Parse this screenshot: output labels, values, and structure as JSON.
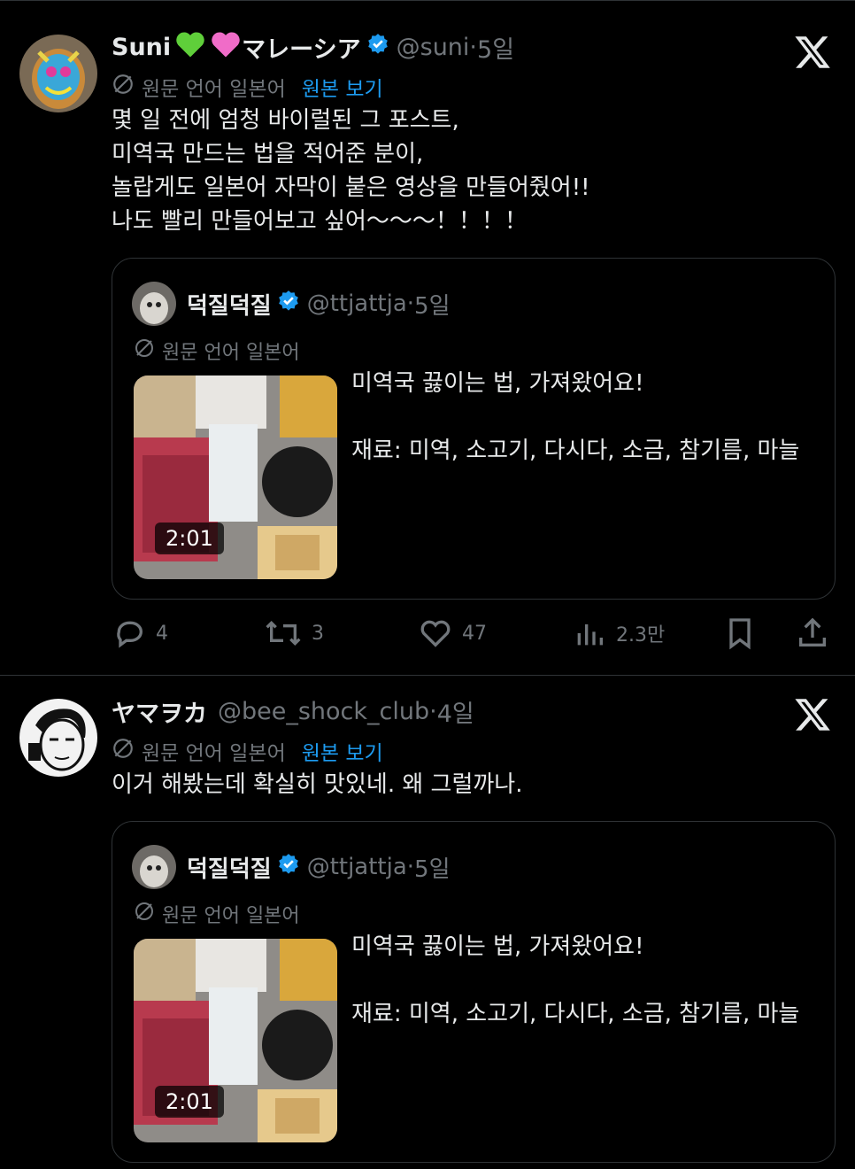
{
  "tweets": [
    {
      "author": {
        "name": "Suni",
        "suffix": "マレーシア",
        "handle": "@suni",
        "time": "5일"
      },
      "lang": {
        "label": "원문 언어 일본어",
        "show_original": "원본 보기"
      },
      "text": "몇 일 전에 엄청 바이럴된 그 포스트,\n미역국 만드는 법을 적어준 분이,\n놀랍게도 일본어 자막이 붙은 영상을 만들어줬어!!\n나도 빨리 만들어보고 싶어～～～！！！！",
      "quote": {
        "author": {
          "name": "덕질덕질",
          "handle": "@ttjattja",
          "time": "5일"
        },
        "lang": "원문 언어 일본어",
        "video_duration": "2:01",
        "line1": "미역국 끓이는 법, 가져왔어요!",
        "line2": "재료: 미역, 소고기, 다시다, 소금, 참기름, 마늘"
      },
      "actions": {
        "replies": "4",
        "retweets": "3",
        "likes": "47",
        "views": "2.3만"
      }
    },
    {
      "author": {
        "name": "ヤマヲカ",
        "handle": "@bee_shock_club",
        "time": "4일"
      },
      "lang": {
        "label": "원문 언어 일본어",
        "show_original": "원본 보기"
      },
      "text": "이거 해봤는데 확실히 맛있네. 왜 그럴까나.",
      "quote": {
        "author": {
          "name": "덕질덕질",
          "handle": "@ttjattja",
          "time": "5일"
        },
        "lang": "원문 언어 일본어",
        "video_duration": "2:01",
        "line1": "미역국 끓이는 법, 가져왔어요!",
        "line2": "재료: 미역, 소고기, 다시다, 소금, 참기름, 마늘"
      }
    }
  ],
  "separator": " · ",
  "colors": {
    "accent": "#1d9bf0",
    "muted": "#71767b",
    "border": "#2f3336",
    "text": "#e7e9ea",
    "heart_green": "#5fcf3a",
    "heart_pink": "#f06cc8"
  },
  "icons": [
    "x-logo-icon",
    "verified-badge-icon",
    "translate-icon",
    "reply-icon",
    "retweet-icon",
    "like-icon",
    "views-icon",
    "bookmark-icon",
    "share-icon",
    "green-heart-icon",
    "pink-heart-icon"
  ]
}
